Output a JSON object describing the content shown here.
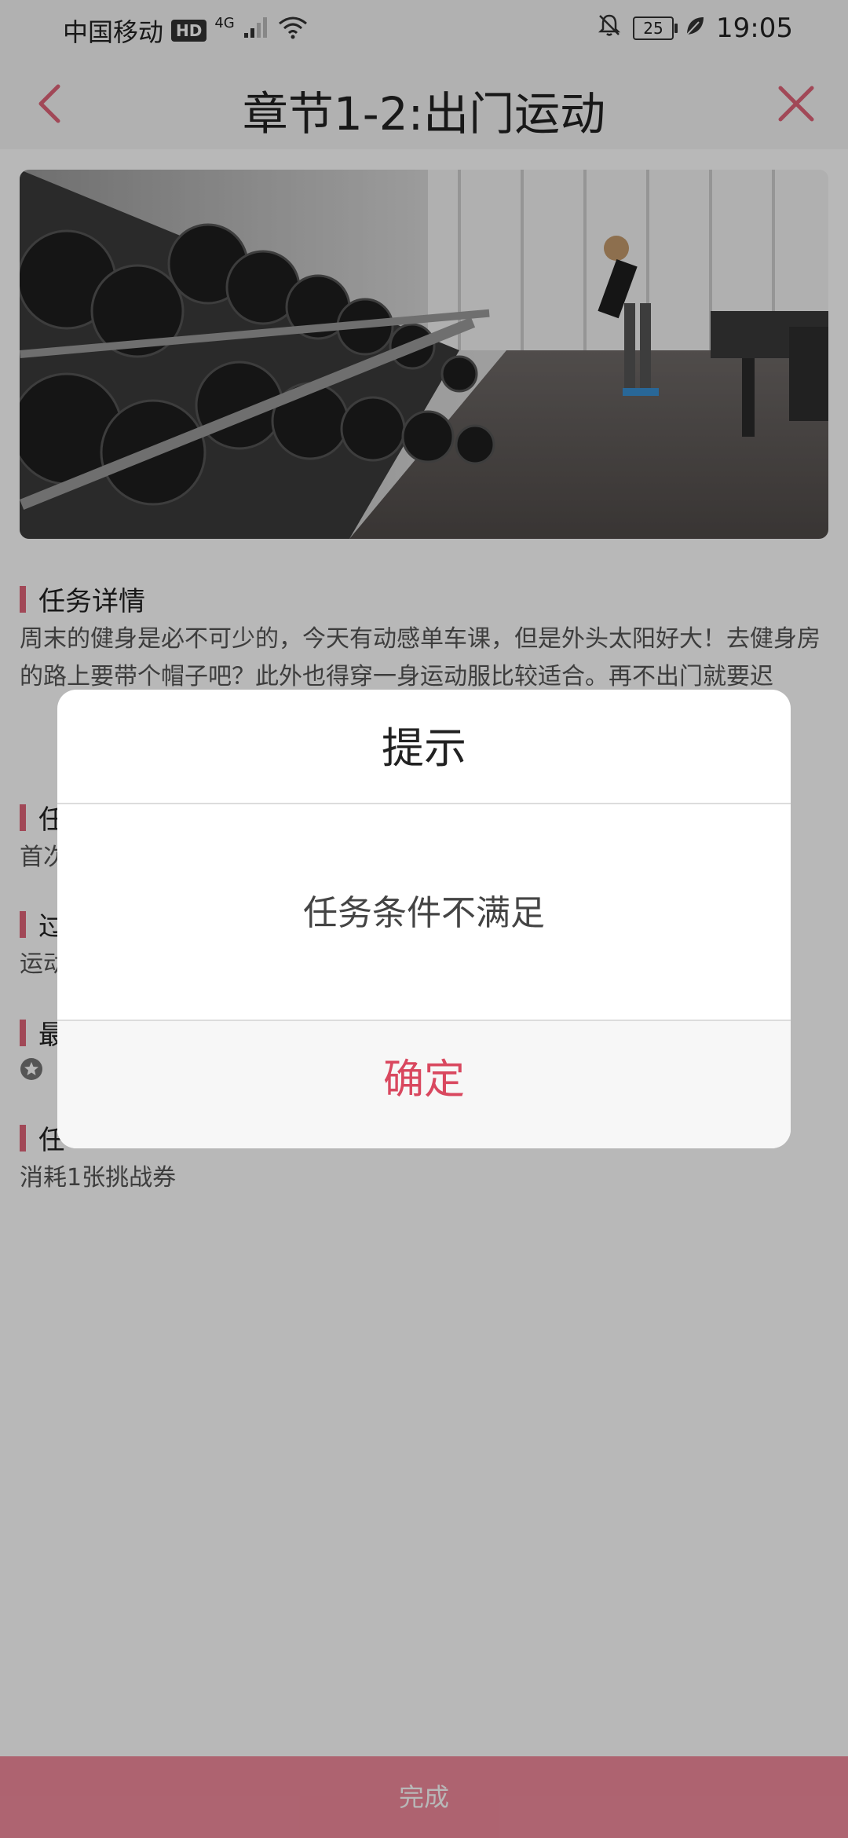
{
  "status_bar": {
    "carrier": "中国移动",
    "hd_badge": "HD",
    "network_type": "4G",
    "battery_level": "25",
    "time": "19:05"
  },
  "nav": {
    "title": "章节1-2:出门运动",
    "back_icon": "chevron-left-icon",
    "close_icon": "close-icon",
    "accent_color": "#e06479"
  },
  "sections": {
    "task_details": {
      "title": "任务详情",
      "text": "周末的健身是必不可少的，今天有动感单车课，但是外头太阳好大！去健身房的路上要带个帽子吧？此外也得穿一身运动服比较适合。再不出门就要迟"
    },
    "section2": {
      "title": "任",
      "text": "首次"
    },
    "section3": {
      "title": "过",
      "text": "运动"
    },
    "section4": {
      "title": "最"
    },
    "section5": {
      "title": "任",
      "text": "消耗1张挑战券"
    }
  },
  "dialog": {
    "title": "提示",
    "message": "任务条件不满足",
    "confirm_label": "确定",
    "confirm_color": "#d9485f"
  },
  "bottom_bar": {
    "complete_label": "完成",
    "color": "#f18a9c"
  }
}
